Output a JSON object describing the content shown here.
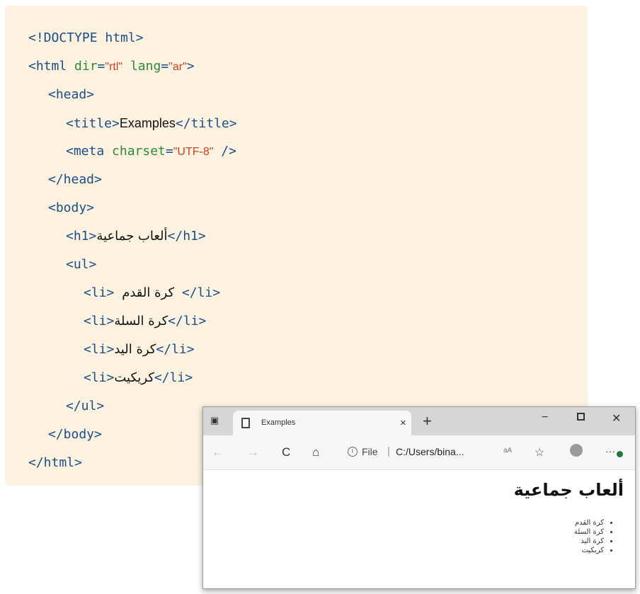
{
  "code": {
    "doctype": "<!DOCTYPE html>",
    "html_open_start": "<html ",
    "attr_dir": "dir",
    "val_rtl": "rtl",
    "attr_lang": "lang",
    "val_ar": "ar",
    "html_open_end": ">",
    "head_open": "<head>",
    "title_open": "<title>",
    "title_text": "Examples",
    "title_close": "</title>",
    "meta_open": "<meta ",
    "attr_charset": "charset",
    "val_utf8": "UTF-8",
    "meta_close": " />",
    "head_close": "</head>",
    "body_open": "<body>",
    "h1_open": "<h1>",
    "h1_text": "ألعاب جماعية",
    "h1_close": "</h1>",
    "ul_open": "<ul>",
    "li_open": "<li>",
    "li_close": "</li>",
    "items": [
      "كرة القدم",
      "كرة السلة",
      "كرة اليد",
      "كريكيت"
    ],
    "ul_close": "</ul>",
    "body_close": "</body>",
    "html_close": "</html>",
    "eq": "=",
    "quote": "\""
  },
  "browser": {
    "tab_title": "Examples",
    "tab_close": "×",
    "new_tab": "+",
    "min_glyph": "−",
    "close_glyph": "✕",
    "back_glyph": "←",
    "fwd_glyph": "→",
    "reload_glyph": "C",
    "home_glyph": "⌂",
    "info_glyph": "i",
    "file_label": "File",
    "separator": "|",
    "url": "C:/Users/bina...",
    "read_aloud": "aA",
    "fav_glyph": "☆",
    "more_glyph": "···",
    "page_heading": "ألعاب جماعية",
    "page_items": [
      "كرة القدم",
      "كرة السلة",
      "كرة اليد",
      "كريكيت"
    ]
  }
}
